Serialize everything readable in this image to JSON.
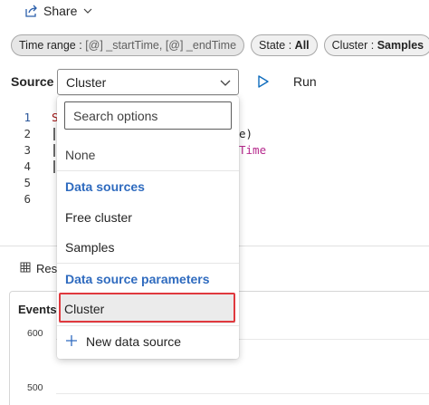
{
  "toolbar": {
    "share_label": "Share"
  },
  "parameters": [
    {
      "key": "Time range : ",
      "value": "[@] _startTime, [@] _endTime",
      "bold": false
    },
    {
      "key": "State : ",
      "value": "All",
      "bold": true
    },
    {
      "key": "Cluster : ",
      "value": "Samples",
      "bold": true
    }
  ],
  "source": {
    "label": "Source",
    "selected": "Cluster"
  },
  "run": {
    "label": "Run"
  },
  "editor": {
    "line_numbers": [
      "1",
      "2",
      "3",
      "4",
      "5",
      "6"
    ],
    "fragments": {
      "line1_start": "S",
      "line2_end": "e)",
      "line3_end": "Time"
    }
  },
  "results": {
    "tab_label": "Resu"
  },
  "chart": {
    "title": "Events l",
    "y_ticks": [
      "600",
      "500"
    ]
  },
  "dropdown": {
    "search_placeholder": "Search options",
    "none_option": "None",
    "group_data_sources": "Data sources",
    "data_sources": [
      "Free cluster",
      "Samples"
    ],
    "group_parameters": "Data source parameters",
    "parameter_options": [
      "Cluster"
    ],
    "new_data_source": "New data source"
  },
  "colors": {
    "accent_blue": "#2f6bbf",
    "highlight_red": "#e0393e",
    "play_blue": "#0f6cbd"
  }
}
